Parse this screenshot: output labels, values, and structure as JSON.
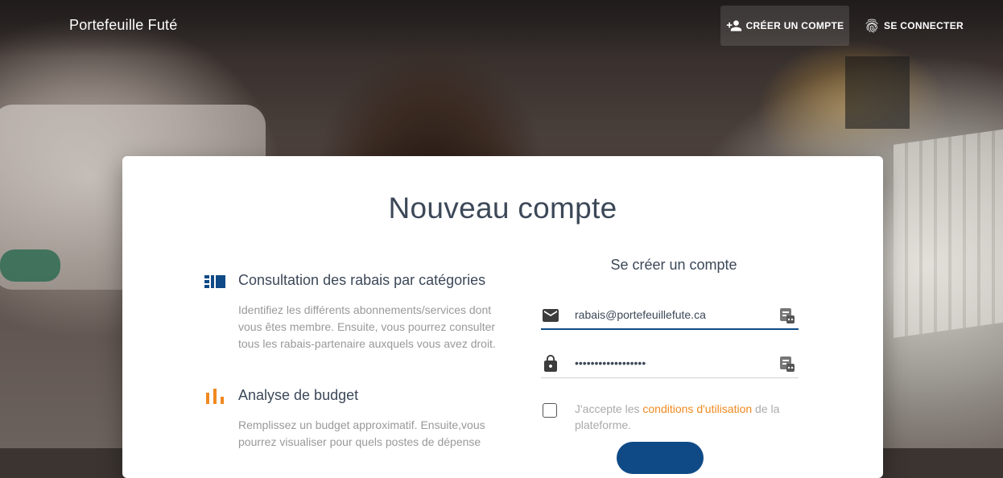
{
  "header": {
    "brand": "Portefeuille Futé",
    "nav": {
      "create_account": "CRÉER UN COMPTE",
      "login": "SE CONNECTER"
    }
  },
  "card": {
    "title": "Nouveau compte",
    "features": [
      {
        "icon": "view-list-icon",
        "title": "Consultation des rabais par catégories",
        "description": "Identifiez les différents abonnements/services dont vous êtes membre. Ensuite, vous pourrez consulter tous les rabais-partenaire auxquels vous avez droit."
      },
      {
        "icon": "bar-chart-icon",
        "title": "Analyse de budget",
        "description": "Remplissez un budget approximatif. Ensuite,vous pourrez visualiser pour quels postes de dépense"
      }
    ],
    "form": {
      "title": "Se créer un compte",
      "email_value": "rabais@portefeuillefute.ca",
      "password_value": "••••••••••••••••••",
      "terms_prefix": "J'accepte les ",
      "terms_link": "conditions d'utilisation",
      "terms_suffix": " de la plateforme."
    }
  },
  "colors": {
    "primary": "#0f4a86",
    "accent": "#f0891f",
    "title_text": "#3c4858",
    "muted_text": "#999999"
  }
}
